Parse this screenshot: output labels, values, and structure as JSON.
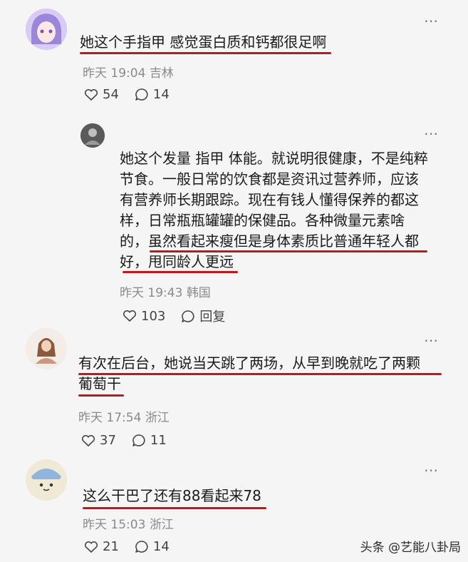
{
  "comments": [
    {
      "text": "她这个手指甲 感觉蛋白质和钙都很足啊",
      "time": "昨天 19:04",
      "location": "吉林",
      "likes": "54",
      "replies": "14"
    },
    {
      "lines": [
        "她这个发量 指甲 体能。就说明很健康，不是纯粹",
        "节食。一般日常的饮食都是资讯过营养师，应该",
        "有营养师长期跟踪。现在有钱人懂得保养的都这",
        "样，日常瓶瓶罐罐的保健品。各种微量元素啥",
        "的，虽然看起来瘦但是身体素质比普通年轻人都",
        "好，甩同龄人更远"
      ],
      "time": "昨天 19:43",
      "location": "韩国",
      "likes": "103",
      "reply_label": "回复"
    },
    {
      "lines": [
        "有次在后台，她说当天跳了两场，从早到晚就吃了两颗",
        "葡萄干"
      ],
      "time": "昨天 17:54",
      "location": "浙江",
      "likes": "37",
      "replies": "11"
    },
    {
      "text": "这么干巴了还有88看起来78",
      "time": "昨天 15:03",
      "location": "浙江",
      "likes": "21",
      "replies": "14"
    }
  ],
  "more_glyph": "⋮",
  "watermark": "头条 @艺能八卦局",
  "accent_color": "#c4161c"
}
